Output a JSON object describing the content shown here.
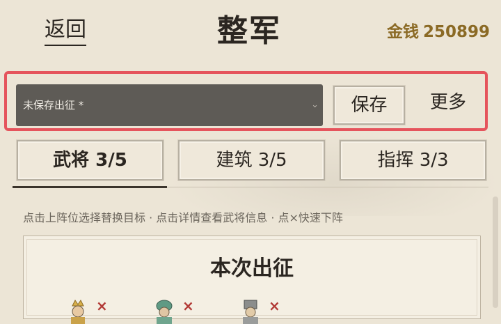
{
  "header": {
    "back_label": "返回",
    "title": "整军",
    "gold_label": "金钱",
    "gold_amount": "250899"
  },
  "toolbar": {
    "plan_value": "未保存出征 *",
    "save_label": "保存",
    "more_label": "更多",
    "highlight_color": "#e5545c"
  },
  "tabs": [
    {
      "label": "武将 3/5",
      "active": true
    },
    {
      "label": "建筑 3/5",
      "active": false
    },
    {
      "label": "指挥 3/3",
      "active": false
    }
  ],
  "hint": "点击上阵位选择替换目标 · 点击详情查看武将信息 · 点×快速下阵",
  "panel": {
    "title": "本次出征",
    "remove_glyph": "×"
  },
  "colors": {
    "background": "#ece5d6",
    "gold_text": "#8b6a25",
    "select_bg": "#5e5b56"
  }
}
